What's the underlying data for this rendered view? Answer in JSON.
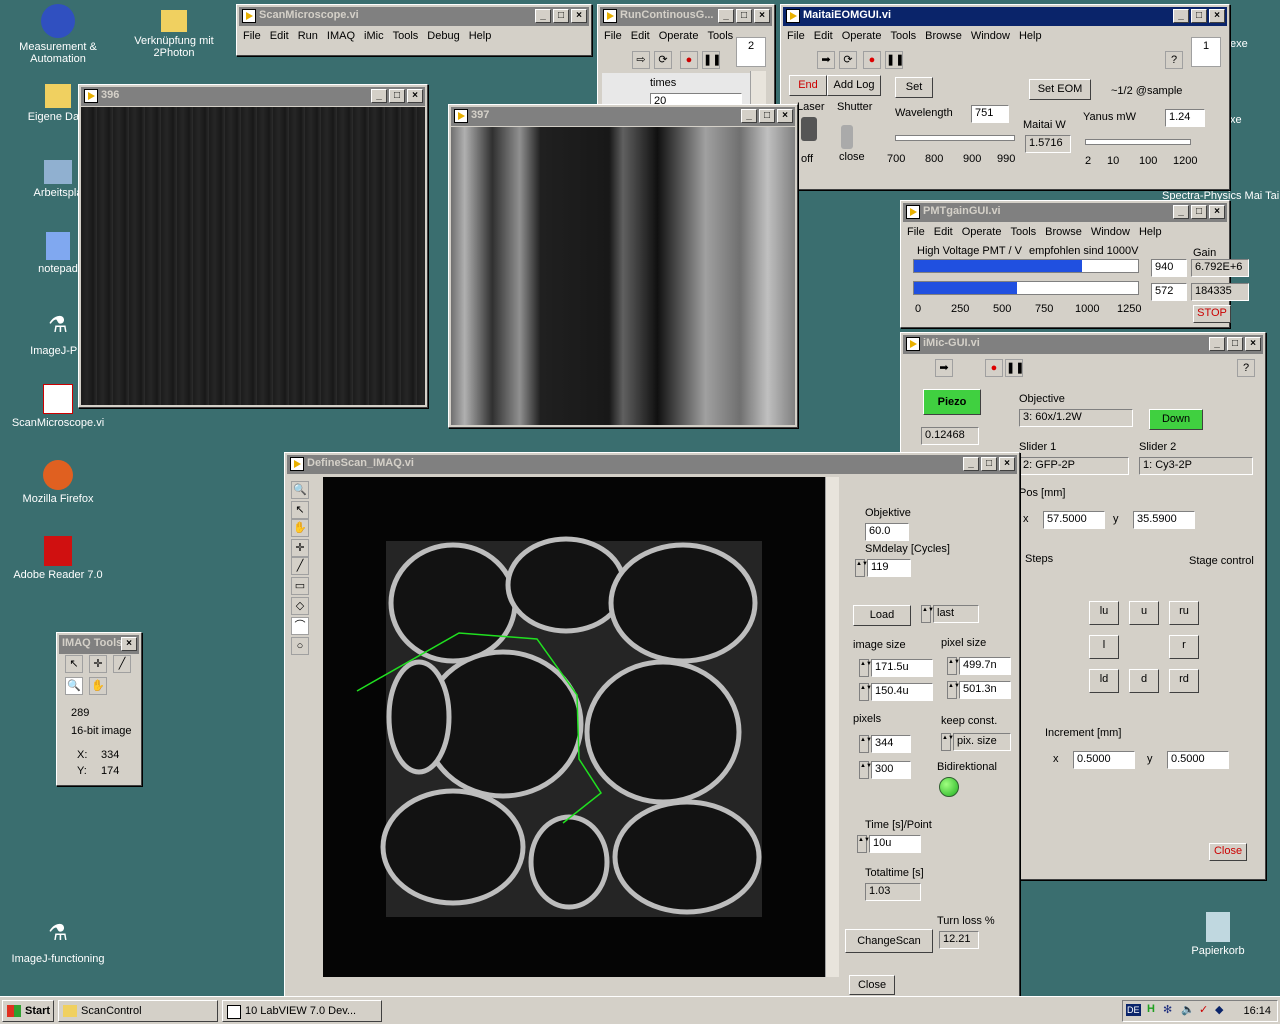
{
  "desktop": {
    "icons": [
      "Measurement & Automation",
      "Verknüpfung mit 2Photon",
      "Eigene Date",
      "Arbeitspla",
      "notepad",
      "ImageJ-Pie",
      "ScanMicroscope.vi",
      "Mozilla Firefox",
      "Adobe Reader 7.0",
      "ImageJ-functioning",
      "Papierkorb"
    ],
    "peek": [
      "exe",
      "xe",
      "Spectra-Physics Mai Tai"
    ]
  },
  "scanmicro": {
    "title": "ScanMicroscope.vi",
    "menu": [
      "File",
      "Edit",
      "Run",
      "IMAQ",
      "iMic",
      "Tools",
      "Debug",
      "Help"
    ]
  },
  "runcont": {
    "title": "RunContinousG...",
    "menu": [
      "File",
      "Edit",
      "Operate",
      "Tools"
    ],
    "times_label": "times",
    "times_value": "20",
    "badge": "2"
  },
  "maitai": {
    "title": "MaitaiEOMGUI.vi",
    "menu": [
      "File",
      "Edit",
      "Operate",
      "Tools",
      "Browse",
      "Window",
      "Help"
    ],
    "end": "End",
    "addlog": "Add Log",
    "set": "Set",
    "set_eom": "Set EOM",
    "laser": "Laser",
    "shutter": "Shutter",
    "off": "off",
    "close": "close",
    "wavelength": "Wavelength",
    "wavelength_val": "751",
    "wl_ticks": [
      "700",
      "800",
      "900",
      "990"
    ],
    "maitai_w": "Maitai W",
    "maitai_w_val": "1.5716",
    "sample": "~1/2 @sample",
    "yanus": "Yanus mW",
    "yanus_val": "1.24",
    "yanus_ticks": [
      "2",
      "10",
      "100",
      "1200"
    ],
    "badge": "1"
  },
  "pmt": {
    "title": "PMTgainGUI.vi",
    "menu": [
      "File",
      "Edit",
      "Operate",
      "Tools",
      "Browse",
      "Window",
      "Help"
    ],
    "hv": "High Voltage PMT / V",
    "empf": "empfohlen sind 1000V",
    "gain": "Gain",
    "v1": "940",
    "v2": "572",
    "g1": "6.792E+6",
    "g2": "184335",
    "ticks": [
      "0",
      "250",
      "500",
      "750",
      "1000",
      "1250"
    ],
    "stop": "STOP",
    "bar1": 0.752,
    "bar2": 0.458
  },
  "imic": {
    "title": "iMic-GUI.vi",
    "piezo": "Piezo",
    "piezo_val": "0.12468",
    "objective": "Objective",
    "objective_val": "3: 60x/1.2W",
    "down": "Down",
    "slider1": "Slider 1",
    "slider1_val": "2: GFP-2P",
    "slider2": "Slider 2",
    "slider2_val": "1: Cy3-2P",
    "pos": "Pos [mm]",
    "x": "x",
    "y": "y",
    "x_val": "57.5000",
    "y_val": "35.5900",
    "steps": "Steps",
    "stage": "Stage control",
    "dirs": [
      "lu",
      "u",
      "ru",
      "l",
      "r",
      "ld",
      "d",
      "rd"
    ],
    "increment": "Increment [mm]",
    "inc_x": "0.5000",
    "inc_y": "0.5000",
    "close": "Close"
  },
  "w396": {
    "title": "396"
  },
  "w397": {
    "title": "397"
  },
  "define": {
    "title": "DefineScan_IMAQ.vi",
    "objektive": "Objektive",
    "objektive_val": "60.0",
    "smdelay": "SMdelay [Cycles]",
    "smdelay_val": "119",
    "load": "Load",
    "last": "last",
    "image_size": "image size",
    "pixel_size": "pixel size",
    "is1": "171.5u",
    "is2": "150.4u",
    "ps1": "499.7n",
    "ps2": "501.3n",
    "pixels": "pixels",
    "keep": "keep const.",
    "px1": "344",
    "px2": "300",
    "pixsize": "pix. size",
    "bidir": "Bidirektional",
    "time": "Time [s]/Point",
    "time_val": "10u",
    "total": "Totaltime [s]",
    "total_val": "1.03",
    "turn": "Turn loss %",
    "turn_val": "12.21",
    "changescan": "ChangeScan",
    "close": "Close"
  },
  "imaq": {
    "title": "IMAQ Tools",
    "val": "289",
    "bit": "16-bit image",
    "x": "X:",
    "y": "Y:",
    "xv": "334",
    "yv": "174"
  },
  "taskbar": {
    "start": "Start",
    "t1": "ScanControl",
    "t2": "10 LabVIEW 7.0 Dev...",
    "lang": "DE",
    "time": "16:14"
  }
}
